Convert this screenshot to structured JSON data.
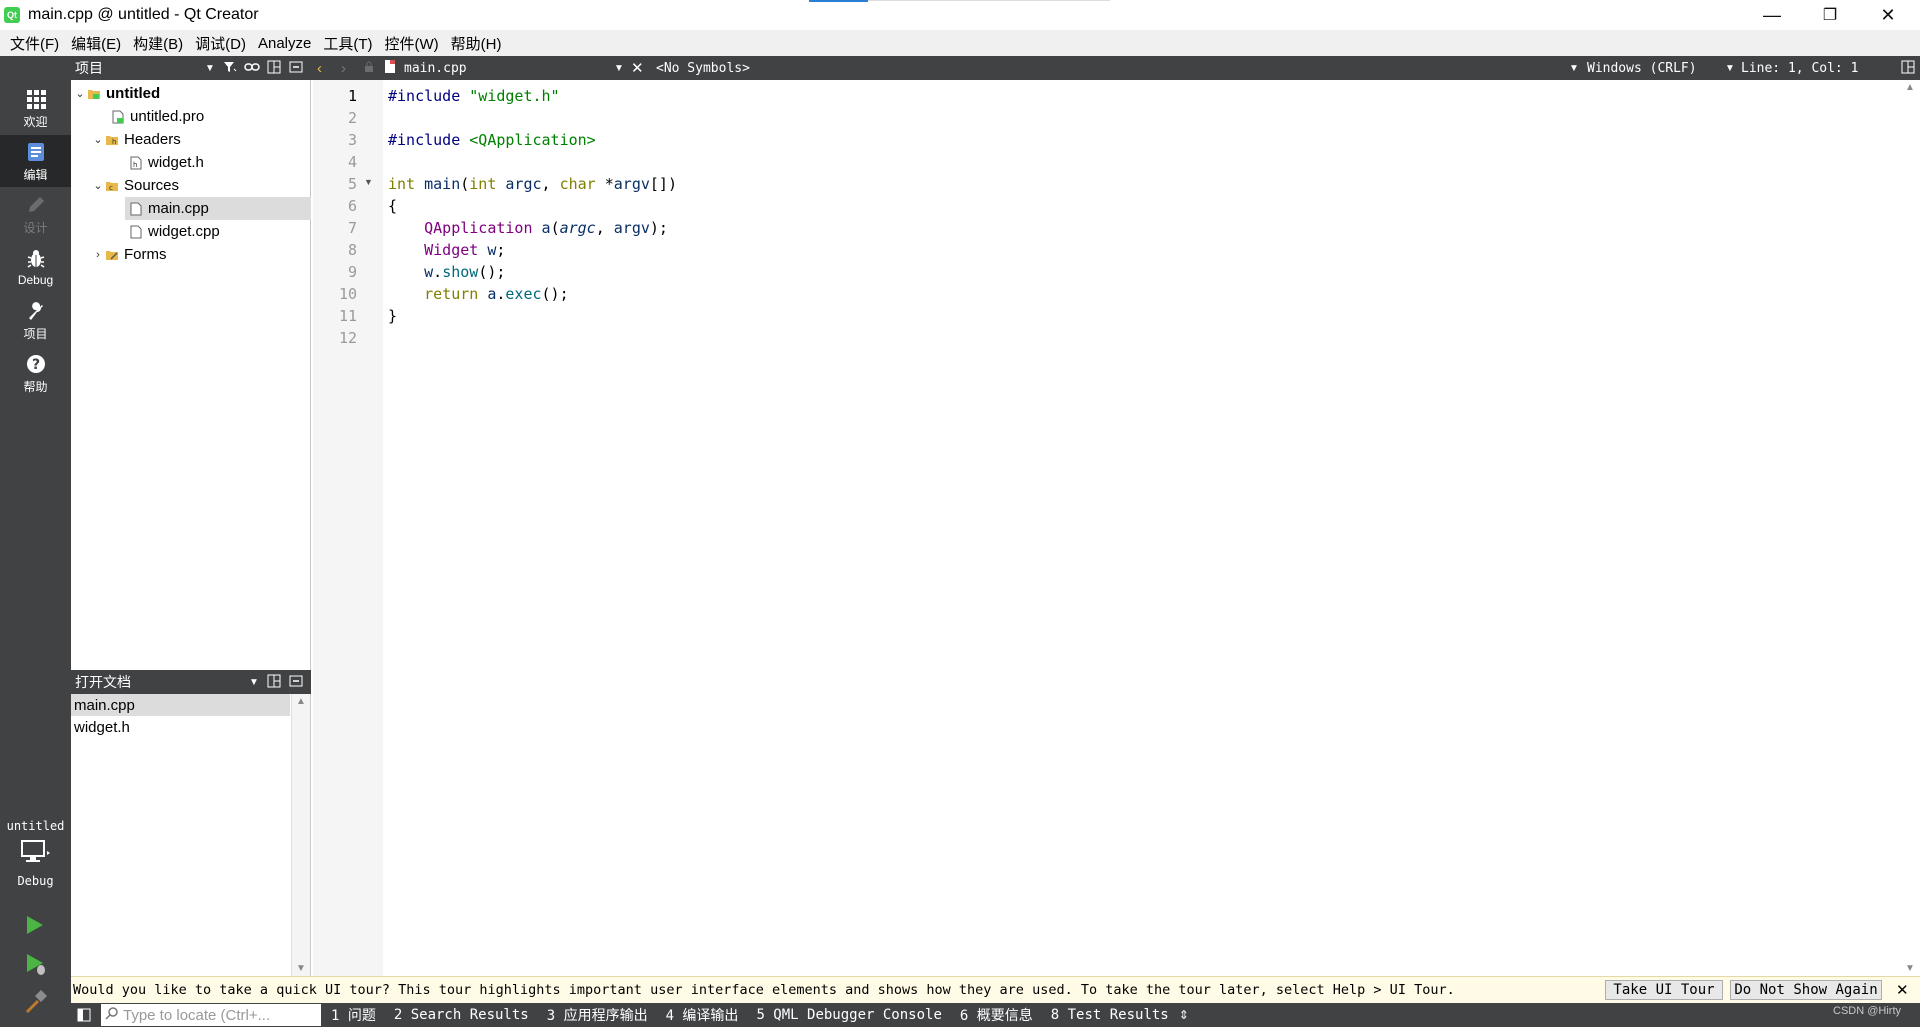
{
  "window": {
    "title": "main.cpp @ untitled - Qt Creator",
    "icon_text": "Qt",
    "minimize": "—",
    "maximize": "❐",
    "close": "✕"
  },
  "menubar": {
    "items": [
      "文件(F)",
      "编辑(E)",
      "构建(B)",
      "调试(D)",
      "Analyze",
      "工具(T)",
      "控件(W)",
      "帮助(H)"
    ]
  },
  "modes": {
    "items": [
      "欢迎",
      "编辑",
      "设计",
      "Debug",
      "项目",
      "帮助"
    ],
    "active": "编辑",
    "kit": {
      "project": "untitled",
      "config": "Debug"
    }
  },
  "project_panel": {
    "title": "项目",
    "tree": [
      {
        "label": "untitled"
      },
      {
        "label": "untitled.pro"
      },
      {
        "label": "Headers"
      },
      {
        "label": "widget.h"
      },
      {
        "label": "Sources"
      },
      {
        "label": "main.cpp"
      },
      {
        "label": "widget.cpp"
      },
      {
        "label": "Forms"
      }
    ]
  },
  "open_docs": {
    "title": "打开文档",
    "items": [
      "main.cpp",
      "widget.h"
    ]
  },
  "editor_toolbar": {
    "file": "main.cpp",
    "symbols": "<No Symbols>",
    "line_ending": "Windows (CRLF)",
    "position": "Line: 1, Col: 1"
  },
  "editor": {
    "current_line": 1,
    "lines": [
      "#include \"widget.h\"",
      "",
      "#include <QApplication>",
      "",
      "int main(int argc, char *argv[])",
      "{",
      "    QApplication a(argc, argv);",
      "    Widget w;",
      "    w.show();",
      "    return a.exec();",
      "}",
      ""
    ]
  },
  "info_bar": {
    "message": "Would you like to take a quick UI tour? This tour highlights important user interface elements and shows how they are used. To take the tour later, select Help > UI Tour.",
    "take_tour": "Take UI Tour",
    "dont_show": "Do Not Show Again"
  },
  "output_bar": {
    "locator_placeholder": "Type to locate (Ctrl+...",
    "tabs": [
      "1 问题",
      "2 Search Results",
      "3 应用程序输出",
      "4 编译输出",
      "5 QML Debugger Console",
      "6 概要信息",
      "8 Test Results"
    ],
    "watermark": "CSDN @Hirty"
  }
}
